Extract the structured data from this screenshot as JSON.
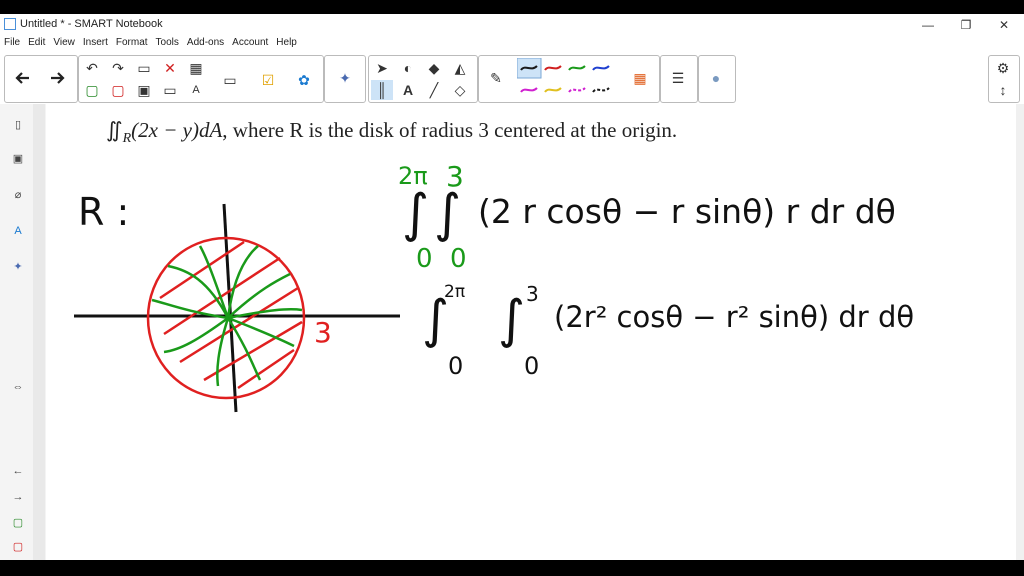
{
  "window": {
    "title": "Untitled * - SMART Notebook",
    "minimize": "—",
    "restore": "❐",
    "close": "✕"
  },
  "menu": [
    "File",
    "Edit",
    "View",
    "Insert",
    "Format",
    "Tools",
    "Add-ons",
    "Account",
    "Help"
  ],
  "toolbar": {
    "back_icon": "arrow-left-icon",
    "forward_icon": "arrow-right-icon",
    "pen_colors": [
      "#1a1a1a",
      "#d02020",
      "#1a9a1a",
      "#2040d0",
      "#d020d0",
      "#e0c020",
      "#d020d0",
      "#1a1a1a"
    ]
  },
  "problem": {
    "integral": "∬",
    "sub": "R",
    "integrand": "(2x − y)dA",
    "text": ", where R is the disk of radius 3 centered at the origin."
  },
  "handwriting": {
    "region_label": "R :",
    "radius_label": "3",
    "line1_upper": "2π",
    "line1_upper2": "3",
    "line1_lower": "0",
    "line1_lower2": "0",
    "line1_body": "(2 r cosθ − r sinθ) r dr dθ",
    "line2_upper": "2π",
    "line2_upper2": "3",
    "line2_lower": "0",
    "line2_lower2": "0",
    "line2_body": "(2r² cosθ − r² sinθ) dr dθ"
  },
  "colors": {
    "red": "#e02020",
    "green": "#1a9a1a",
    "black": "#111111"
  }
}
